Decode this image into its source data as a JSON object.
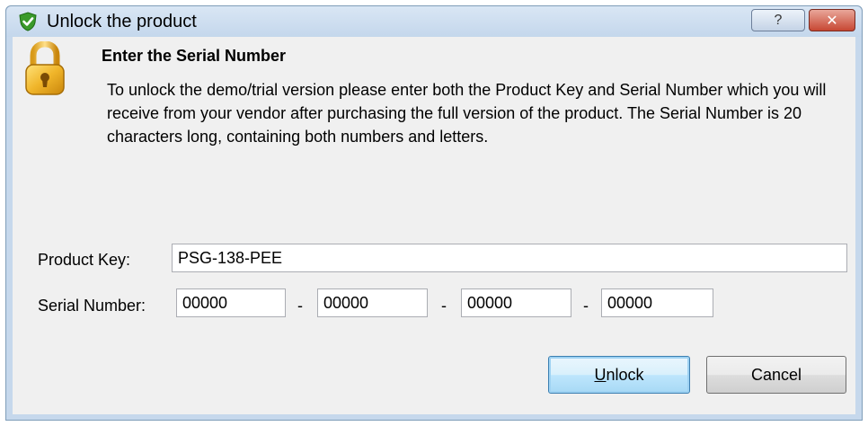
{
  "window": {
    "title": "Unlock the product",
    "help_label": "?",
    "close_label": "✕"
  },
  "content": {
    "heading": "Enter the Serial Number",
    "description": "To unlock the demo/trial version please enter both the Product Key and Serial Number which you will receive from your vendor after purchasing the full version of the product. The Serial Number is 20 characters long, containing both numbers and letters."
  },
  "form": {
    "product_key_label": "Product Key:",
    "product_key_value": "PSG-138-PEE",
    "serial_label": "Serial Number:",
    "serial_parts": [
      "00000",
      "00000",
      "00000",
      "00000"
    ],
    "separator": "-"
  },
  "buttons": {
    "unlock_mnemonic": "U",
    "unlock_rest": "nlock",
    "cancel_label": "Cancel"
  },
  "icons": {
    "title_icon": "green-shield-check-icon",
    "lock_icon": "gold-padlock-icon"
  }
}
